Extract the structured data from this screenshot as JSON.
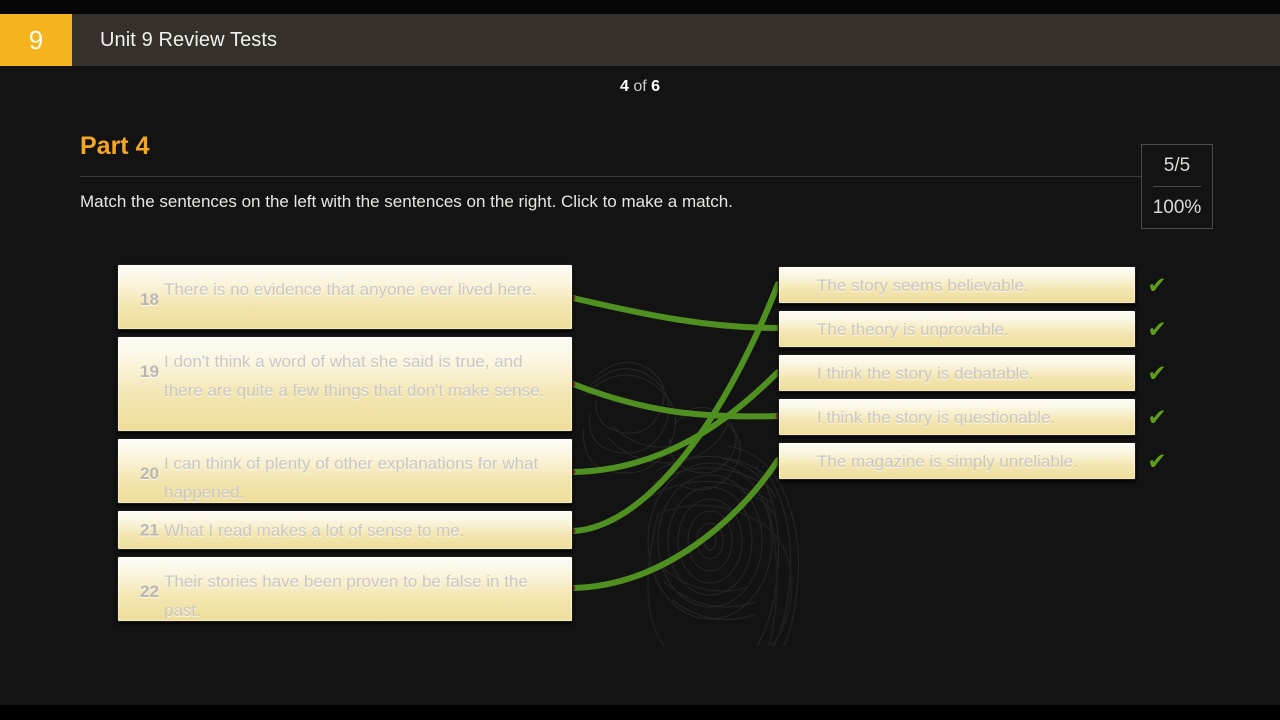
{
  "header": {
    "unit_badge": "9",
    "title": "Unit 9 Review Tests"
  },
  "page_counter": {
    "current": "4",
    "separator": "of",
    "total": "6"
  },
  "part": {
    "title": "Part 4",
    "instructions": "Match the sentences on the left with the sentences on the right. Click to make a match."
  },
  "score": {
    "fraction": "5/5",
    "percent": "100%"
  },
  "colors": {
    "accent": "#f5b41e",
    "part_title": "#f5a623",
    "header_bar": "#36302c",
    "stage_bg": "#131313",
    "card_top": "#fdfcf7",
    "card_bottom": "#eedd9a",
    "line": "#4f9020",
    "check": "#5f9e1c"
  },
  "left_items": [
    {
      "num": "18",
      "text": "There is no evidence that anyone ever lived here."
    },
    {
      "num": "19",
      "text": "I don't think a word of what she said is true, and there are quite a few things that don't make sense."
    },
    {
      "num": "20",
      "text": "I can think of plenty of other explanations for what happened."
    },
    {
      "num": "21",
      "text": "What I read makes a lot of sense to me."
    },
    {
      "num": "22",
      "text": "Their stories have been proven to be false in the past."
    }
  ],
  "right_items": [
    {
      "text": "The story seems believable."
    },
    {
      "text": "The theory is unprovable."
    },
    {
      "text": "I think the story is debatable."
    },
    {
      "text": "I think the story is questionable."
    },
    {
      "text": "The magazine is simply unreliable."
    }
  ],
  "checkmarks": [
    "✔",
    "✔",
    "✔",
    "✔",
    "✔"
  ],
  "matches": [
    {
      "from": "18",
      "to": "The theory is unprovable."
    },
    {
      "from": "19",
      "to": "I think the story is questionable."
    },
    {
      "from": "20",
      "to": "I think the story is debatable."
    },
    {
      "from": "21",
      "to": "The story seems believable."
    },
    {
      "from": "22",
      "to": "The magazine is simply unreliable."
    }
  ]
}
